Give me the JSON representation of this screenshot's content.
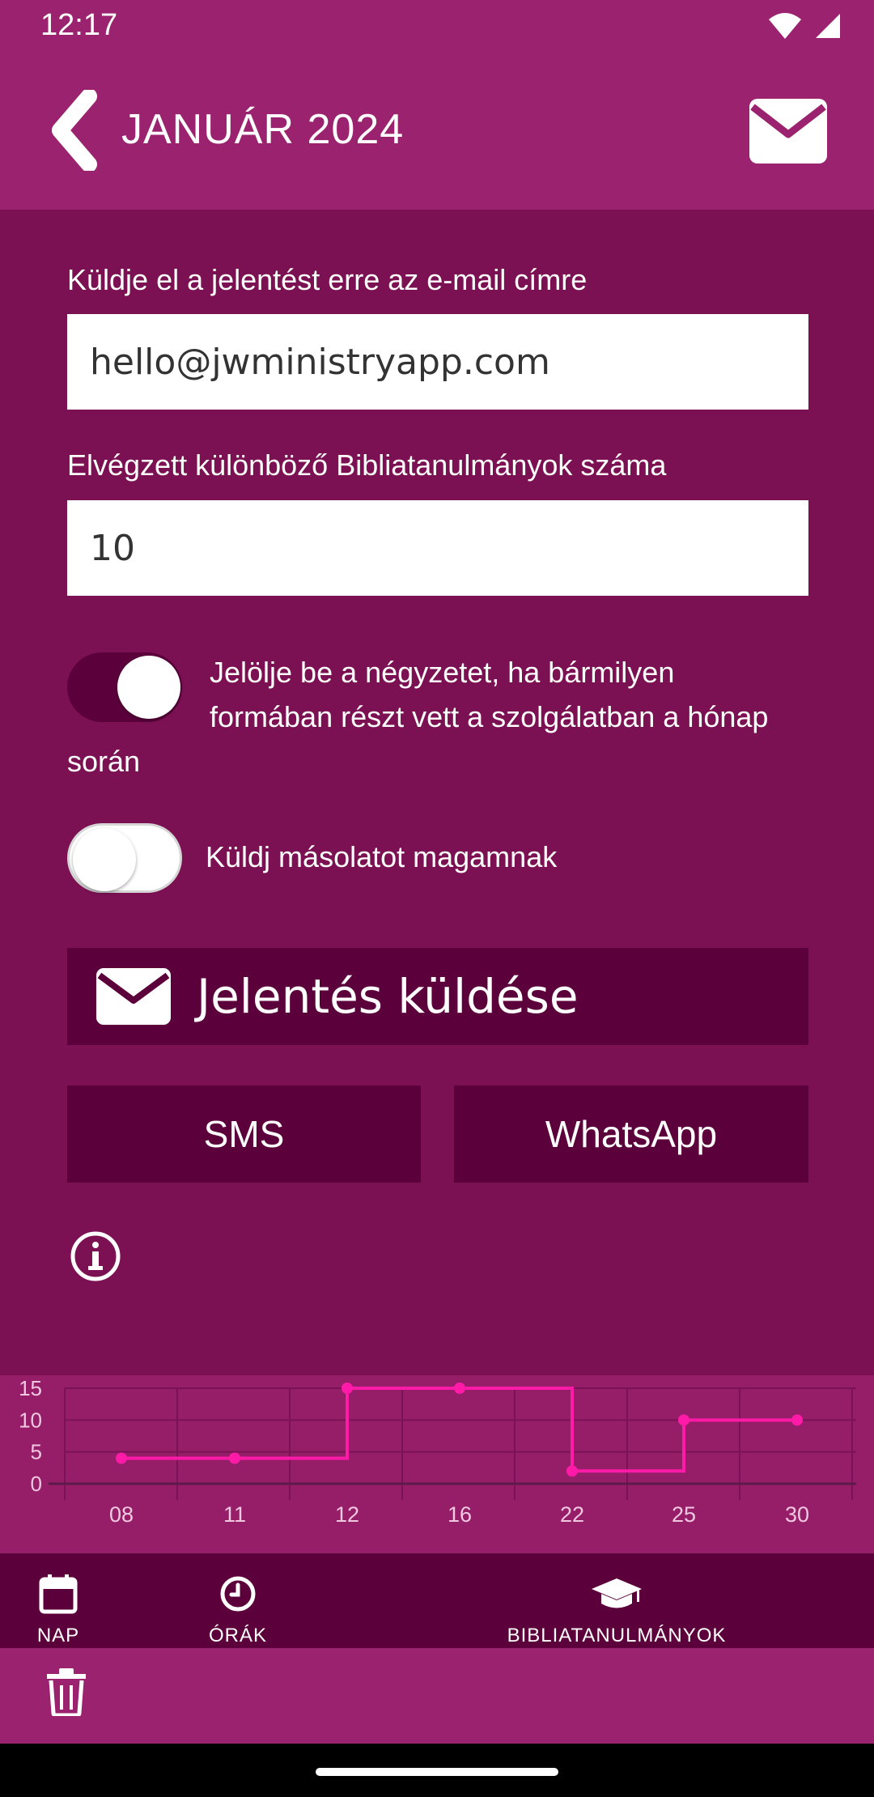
{
  "status_bar": {
    "time": "12:17"
  },
  "header": {
    "title": "JANUÁR 2024"
  },
  "form": {
    "email_label": "Küldje el a jelentést erre az e-mail címre",
    "email_value": "hello@jwministryapp.com",
    "studies_label": "Elvégzett különböző Bibliatanulmányok száma",
    "studies_value": "10",
    "participation_toggle": {
      "line1": "Jelölje be a négyzetet, ha bármilyen",
      "line2": "formában részt vett a szolgálatban a hónap",
      "line3": "során",
      "state": "on"
    },
    "copy_toggle": {
      "label": "Küldj másolatot magamnak",
      "state": "off"
    }
  },
  "buttons": {
    "send_report": "Jelentés küldése",
    "sms": "SMS",
    "whatsapp": "WhatsApp"
  },
  "colors": {
    "background": "#7b1153",
    "header": "#9b226e",
    "button": "#5c003c",
    "chart_line": "#ff1aa8"
  },
  "chart_data": {
    "type": "line",
    "step": true,
    "categories": [
      "08",
      "11",
      "12",
      "16",
      "22",
      "25",
      "30"
    ],
    "values": [
      4,
      4,
      15,
      15,
      2,
      10,
      10
    ],
    "y_ticks": [
      "15",
      "10",
      "5",
      "0"
    ],
    "ylim": [
      0,
      15
    ],
    "grid": true
  },
  "bottom_nav": {
    "items": [
      {
        "label": "NAP",
        "icon": "calendar-icon"
      },
      {
        "label": "ÓRÁK",
        "icon": "clock-icon"
      },
      {
        "label": "BIBLIATANULMÁNYOK",
        "icon": "graduation-cap-icon"
      }
    ]
  },
  "toolbar": {
    "icon": "trash-icon"
  }
}
